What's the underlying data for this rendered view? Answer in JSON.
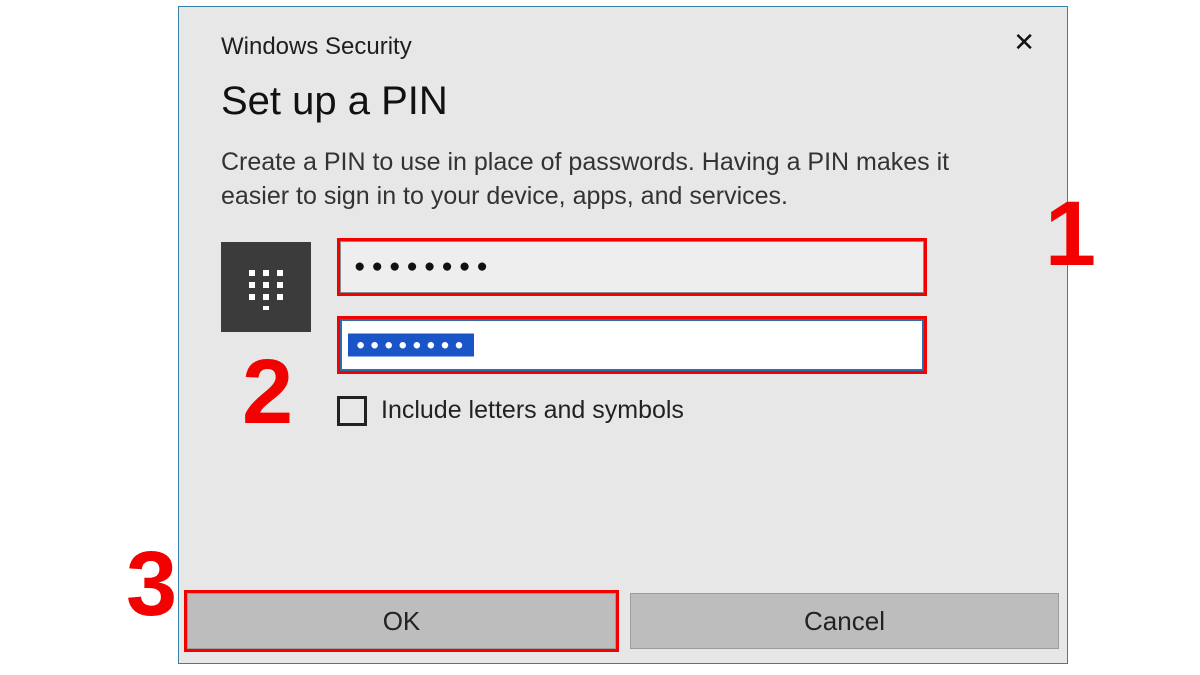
{
  "dialog": {
    "title": "Windows Security",
    "heading": "Set up a PIN",
    "description": "Create a PIN to use in place of passwords. Having a PIN makes it easier to sign in to your device, apps, and services.",
    "pin1_mask": "●●●●●●●●",
    "pin2_mask": "●●●●●●●●",
    "checkbox_label": "Include letters and symbols",
    "ok_label": "OK",
    "cancel_label": "Cancel"
  },
  "annotations": {
    "one": "1",
    "two": "2",
    "three": "3",
    "highlight_color": "#f30000"
  }
}
